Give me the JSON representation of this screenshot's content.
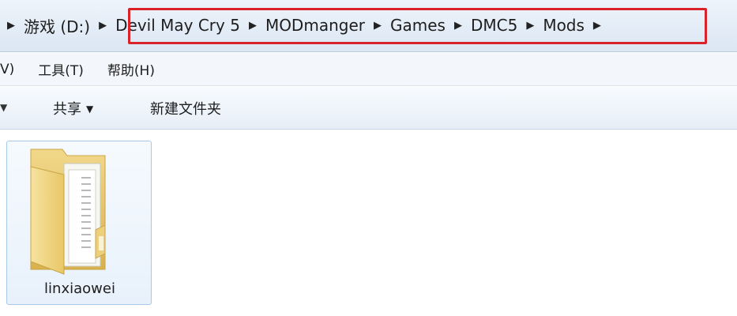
{
  "address_bar": {
    "crumbs": [
      "游戏 (D:)",
      "Devil May Cry 5",
      "MODmanger",
      "Games",
      "DMC5",
      "Mods"
    ],
    "highlight_color": "#d8232a"
  },
  "menu_bar": {
    "partial_item": "V)",
    "tools": "工具(T)",
    "help": "帮助(H)"
  },
  "command_bar": {
    "share": "共享",
    "new_folder": "新建文件夹"
  },
  "content": {
    "items": [
      {
        "name": "linxiaowei",
        "type": "folder",
        "icon": "folder-icon"
      }
    ]
  }
}
